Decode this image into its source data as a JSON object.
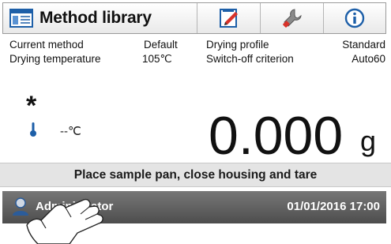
{
  "header": {
    "title": "Method library",
    "icons": [
      "method-library-icon",
      "edit-pencil-icon",
      "wrench-icon",
      "info-icon"
    ]
  },
  "info": {
    "row1": {
      "label_left": "Current method",
      "value_left": "Default",
      "label_right": "Drying profile",
      "value_right": "Standard"
    },
    "row2": {
      "label_left": "Drying temperature",
      "value_left": "105℃",
      "label_right": "Switch-off  criterion",
      "value_right": "Auto60"
    }
  },
  "weighing": {
    "stability_symbol": "*",
    "temperature": "--℃",
    "value": "0.000",
    "unit": "g"
  },
  "instruction": "Place sample pan, close housing and tare",
  "status": {
    "user": "Administrator",
    "datetime": "01/01/2016 17:00"
  },
  "colors": {
    "status_bar": "#5e5e5e",
    "instruction_bar": "#e4e4e4",
    "accent_blue": "#1d5fa8",
    "accent_red": "#d8322a"
  }
}
